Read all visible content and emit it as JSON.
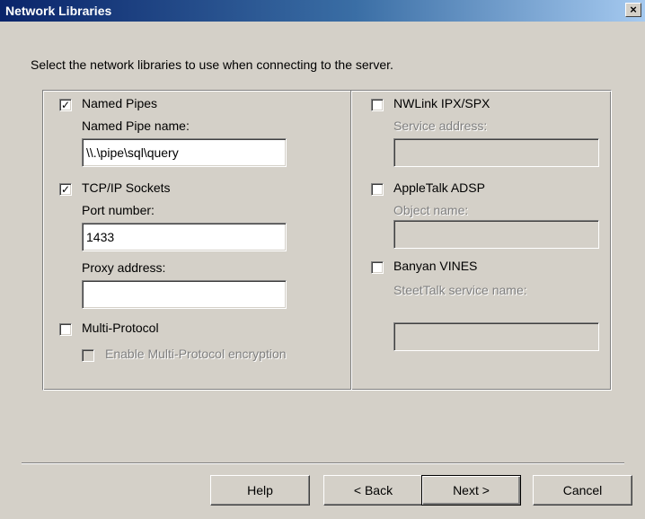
{
  "window": {
    "title": "Network Libraries",
    "close_glyph": "×"
  },
  "intro": "Select the network libraries to use when connecting to the server.",
  "left": {
    "named_pipes": {
      "label": "Named Pipes",
      "checked": true,
      "field_label": "Named Pipe name:",
      "value": "\\\\.\\pipe\\sql\\query"
    },
    "tcpip": {
      "label": "TCP/IP Sockets",
      "checked": true,
      "port_label": "Port number:",
      "port_value": "1433",
      "proxy_label": "Proxy address:",
      "proxy_value": ""
    },
    "multiprotocol": {
      "label": "Multi-Protocol",
      "checked": false,
      "encryption_label": "Enable Multi-Protocol encryption",
      "encryption_checked": false,
      "encryption_enabled": false
    }
  },
  "right": {
    "nwlink": {
      "label": "NWLink IPX/SPX",
      "checked": false,
      "field_label": "Service address:",
      "value": ""
    },
    "appletalk": {
      "label": "AppleTalk ADSP",
      "checked": false,
      "field_label": "Object name:",
      "value": ""
    },
    "banyan": {
      "label": "Banyan VINES",
      "checked": false,
      "field_label": "SteetTalk service name:",
      "value": ""
    }
  },
  "buttons": {
    "help": "Help",
    "back": "< Back",
    "next": "Next >",
    "cancel": "Cancel"
  },
  "check_glyph": "✓"
}
